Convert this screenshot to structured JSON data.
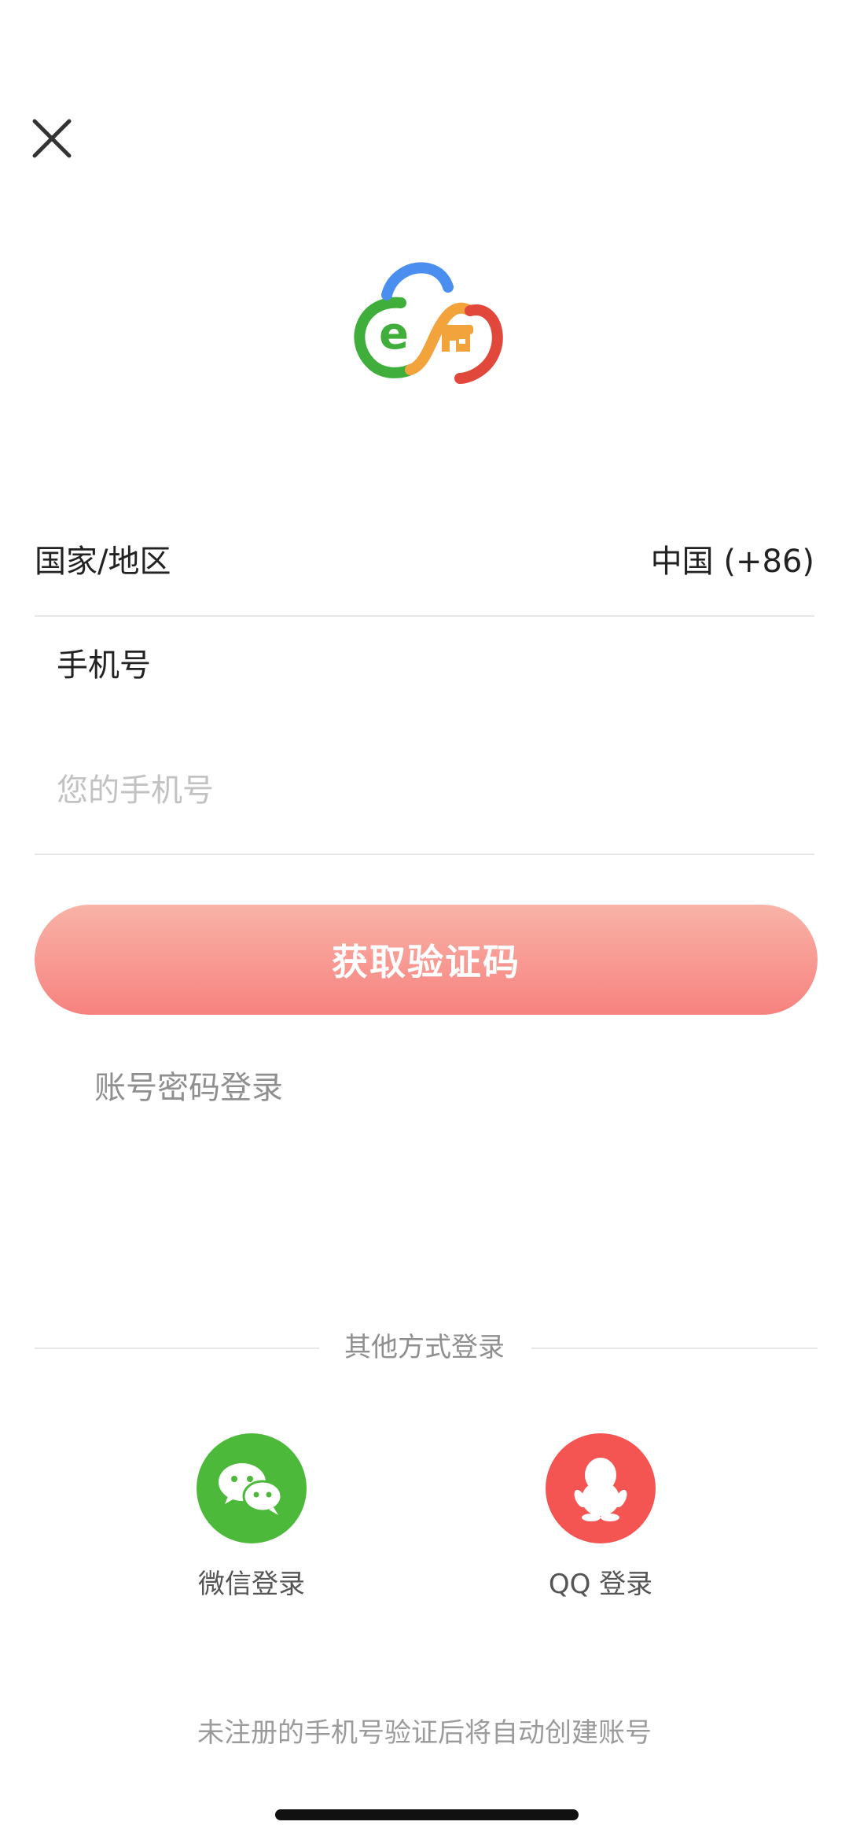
{
  "header": {
    "close_icon": "close-icon"
  },
  "logo": {
    "letter": "e",
    "colors": {
      "green": "#3fae3a",
      "blue": "#4a8ff0",
      "orange": "#f3a33b",
      "red": "#e1473b"
    }
  },
  "form": {
    "region_label": "国家/地区",
    "region_value": "中国 (+86)",
    "phone_label": "手机号",
    "phone_placeholder": "您的手机号",
    "phone_value": ""
  },
  "actions": {
    "get_code": "获取验证码",
    "password_login": "账号密码登录"
  },
  "other": {
    "title": "其他方式登录",
    "wechat": {
      "label": "微信登录",
      "icon": "wechat-icon",
      "color": "#4cb93a"
    },
    "qq": {
      "label": "QQ 登录",
      "icon": "qq-icon",
      "color": "#f45452"
    }
  },
  "footer": {
    "note": "未注册的手机号验证后将自动创建账号"
  }
}
